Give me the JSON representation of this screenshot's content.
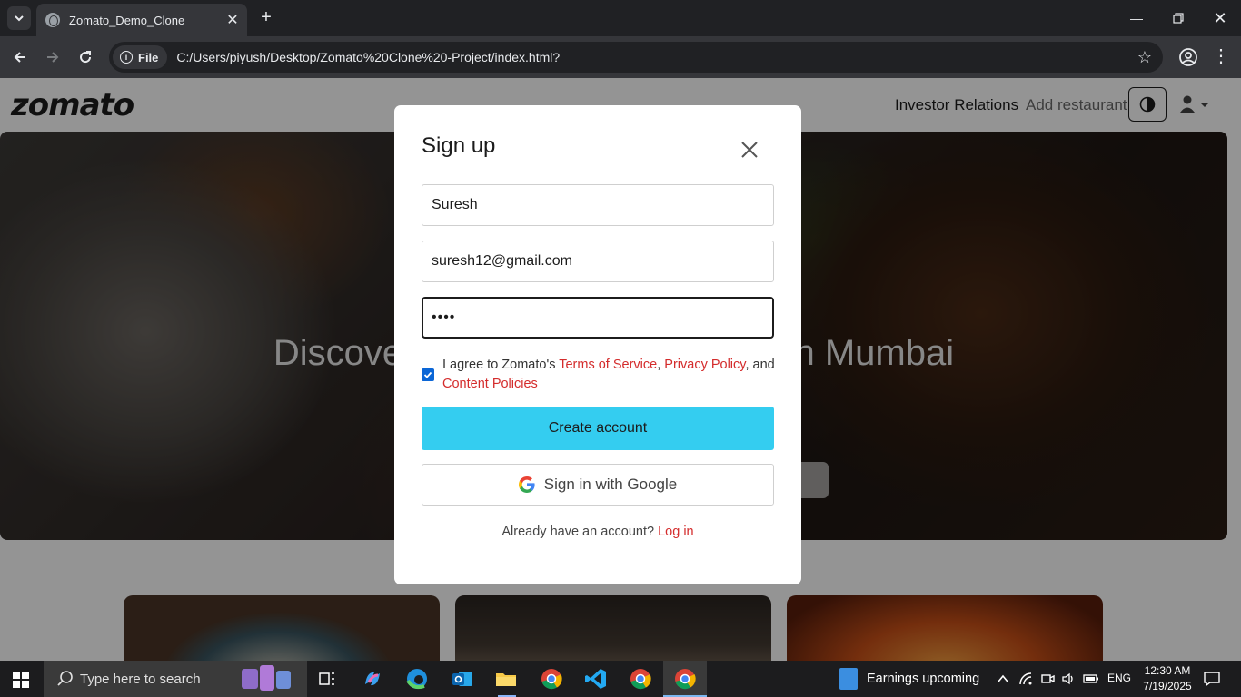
{
  "browser": {
    "tab_title": "Zomato_Demo_Clone",
    "address_chip": "File",
    "url": "C:/Users/piyush/Desktop/Zomato%20Clone%20-Project/index.html?"
  },
  "header": {
    "logo": "zomato",
    "nav_links": [
      "Investor Relations",
      "Add restaurant"
    ]
  },
  "hero": {
    "title": "Discover the best food & drinks in Mumbai"
  },
  "modal": {
    "title": "Sign up",
    "name_value": "Suresh",
    "email_value": "suresh12@gmail.com",
    "password_value": "••••",
    "agree_checked": true,
    "agree_prefix": "I agree to Zomato's ",
    "terms_link": "Terms of Service",
    "comma": ", ",
    "privacy_link": "Privacy Policy",
    "and_text": ", and ",
    "content_link": "Content Policies",
    "create_button": "Create account",
    "google_button": "Sign in with Google",
    "login_prompt": "Already have an account? ",
    "login_link": "Log in"
  },
  "taskbar": {
    "search_placeholder": "Type here to search",
    "news": "Earnings upcoming",
    "language": "ENG",
    "time": "12:30 AM",
    "date": "7/19/2025"
  },
  "colors": {
    "accent_link": "#d42c2c",
    "create_button": "#34cdf0",
    "checkbox": "#0b66d6"
  }
}
